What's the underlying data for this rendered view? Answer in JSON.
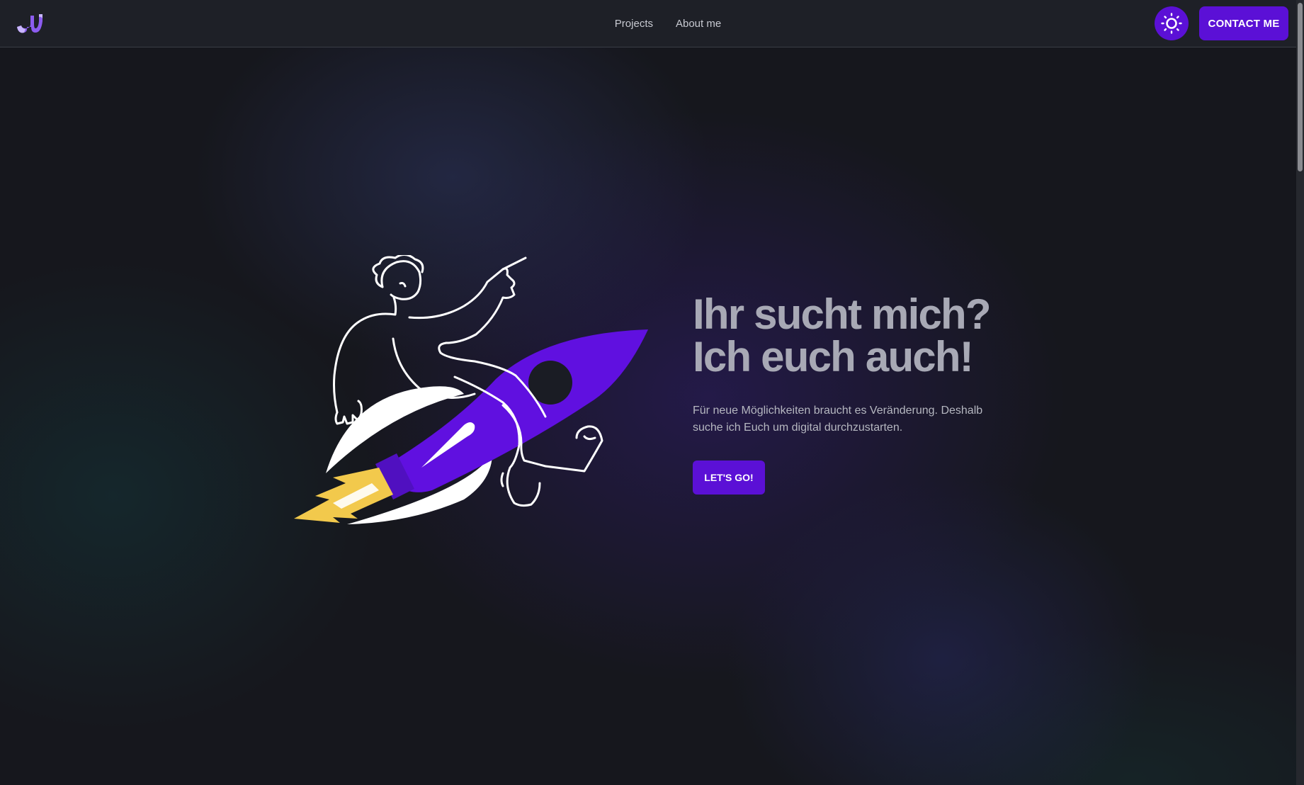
{
  "header": {
    "logo_icon": "brand-logo-icon",
    "nav": [
      {
        "label": "Projects"
      },
      {
        "label": "About me"
      }
    ],
    "theme_toggle_icon": "sun-icon",
    "contact_label": "CONTACT ME"
  },
  "hero": {
    "title_line1": "Ihr sucht mich?",
    "title_line2": "Ich euch auch!",
    "description": "Für neue Möglichkeiten braucht es Veränderung. Deshalb suche ich Euch um digital durchzustarten.",
    "cta_label": "LET'S GO!",
    "illustration_icon": "person-riding-rocket-illustration"
  },
  "colors": {
    "accent": "#5b10d6",
    "flame": "#f2c94c",
    "header_bg": "#1e2027",
    "title": "#a8a9b5"
  }
}
